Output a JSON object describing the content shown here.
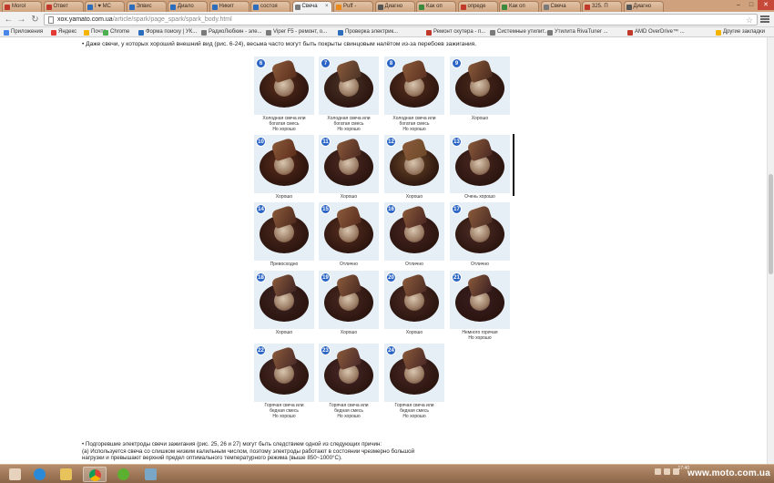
{
  "browser": {
    "tabs": [
      {
        "label": "Morol",
        "color": "#c0392b"
      },
      {
        "label": "Ответ",
        "color": "#c0392b"
      },
      {
        "label": "I ♥ МС",
        "color": "#2c6ebd"
      },
      {
        "label": "Элвис",
        "color": "#2c6ebd"
      },
      {
        "label": "Диало",
        "color": "#2c6ebd"
      },
      {
        "label": "Никит",
        "color": "#2c6ebd"
      },
      {
        "label": "состоя",
        "color": "#2c6ebd"
      },
      {
        "label": "Свеча",
        "color": "#7a7a7a",
        "active": true
      },
      {
        "label": "Puff -",
        "color": "#ea8a1a"
      },
      {
        "label": "Диагно",
        "color": "#555555"
      },
      {
        "label": "Как оп",
        "color": "#3b8a3e"
      },
      {
        "label": "опреде",
        "color": "#c0392b"
      },
      {
        "label": "Как оп",
        "color": "#3b8a3e"
      },
      {
        "label": "Свеча",
        "color": "#7a7a7a"
      },
      {
        "label": "325. П",
        "color": "#c0392b"
      },
      {
        "label": "Диагно",
        "color": "#555555"
      }
    ],
    "url_host": "xox.yamato.com.ua",
    "url_path": "/article/spark/page_spark/spark_body.html",
    "bookmarks": [
      {
        "label": "Приложения",
        "color": "#4a86e8"
      },
      {
        "label": "Яндекс",
        "color": "#e53935"
      },
      {
        "label": "Почта",
        "color": "#f5b400"
      },
      {
        "label": "Chrome",
        "color": "#4caf50"
      },
      {
        "label": "Форма поиску | УК...",
        "color": "#2c6ebd"
      },
      {
        "label": "РадиоЛюбкин - эле...",
        "color": "#7a7a7a"
      },
      {
        "label": "Viper F5 - ремонт, о...",
        "color": "#7a7a7a"
      },
      {
        "label": "Проверка электрик...",
        "color": "#2c6ebd"
      },
      {
        "label": "Ремонт скутера - п...",
        "color": "#c0392b"
      },
      {
        "label": "Системные утилит...",
        "color": "#7a7a7a"
      },
      {
        "label": "Утилита RivaTuner ...",
        "color": "#7a7a7a"
      },
      {
        "label": "AMD OverDrive™ ...",
        "color": "#c0392b"
      },
      {
        "label": "Другие закладки",
        "color": "#f5b400"
      }
    ]
  },
  "page": {
    "intro": "• Даже свечи, у которых хороший внешний вид (рис. 6-24), весьма часто могут быть покрыты свинцовым налётом из-за перебоев зажигания.",
    "plugs": [
      {
        "num": "6",
        "caption": [
          "Холодная свеча или",
          "богатая смесь",
          "Но хорошо"
        ],
        "tint": "#5a2e1c"
      },
      {
        "num": "7",
        "caption": [
          "Холодная свеча или",
          "богатая смесь",
          "Но хорошо"
        ],
        "tint": "#4b3326"
      },
      {
        "num": "8",
        "caption": [
          "Холодная свеча или",
          "богатая смесь",
          "Но хорошо"
        ],
        "tint": "#5b3120"
      },
      {
        "num": "9",
        "caption": [
          "Хорошо"
        ],
        "tint": "#4a2a1d"
      },
      {
        "num": "10",
        "caption": [
          "Хорошо"
        ],
        "tint": "#5d2d1b"
      },
      {
        "num": "11",
        "caption": [
          "Хорошо"
        ],
        "tint": "#4d2a22"
      },
      {
        "num": "12",
        "caption": [
          "Хорошо"
        ],
        "tint": "#6d4a2a"
      },
      {
        "num": "13",
        "caption": [
          "Очень хорошо"
        ],
        "tint": "#4a2822"
      },
      {
        "num": "14",
        "caption": [
          "Превосходно"
        ],
        "tint": "#4e2a1e"
      },
      {
        "num": "15",
        "caption": [
          "Отлично"
        ],
        "tint": "#5a2f20"
      },
      {
        "num": "16",
        "caption": [
          "Отлично"
        ],
        "tint": "#4a2622"
      },
      {
        "num": "17",
        "caption": [
          "Отлично"
        ],
        "tint": "#4e2e26"
      },
      {
        "num": "18",
        "caption": [
          "Хорошо"
        ],
        "tint": "#3e2424"
      },
      {
        "num": "19",
        "caption": [
          "Хорошо"
        ],
        "tint": "#4a2a22"
      },
      {
        "num": "20",
        "caption": [
          "Хорошо"
        ],
        "tint": "#4d2c24"
      },
      {
        "num": "21",
        "caption": [
          "Немного горячая",
          "Но хорошо"
        ],
        "tint": "#3a1f22"
      },
      {
        "num": "22",
        "caption": [
          "Горячая свеча или",
          "бедная смесь",
          "Но хорошо"
        ],
        "tint": "#4a2a28"
      },
      {
        "num": "23",
        "caption": [
          "Горячая свеча или",
          "бедная смесь",
          "Но хорошо"
        ],
        "tint": "#4a2a2a"
      },
      {
        "num": "24",
        "caption": [
          "Горячая свеча или",
          "бедная смесь",
          "Но хорошо"
        ],
        "tint": "#4a2826"
      }
    ],
    "footer": [
      "• Подгоревшие электроды свечи зажигания (рис. 25, 26 и 27) могут быть следствием одной из следующих причин:",
      "  (a) Используется свеча со слишком низким калильным числом, поэтому электроды работают в состоянии чрезмерно большой",
      "  нагрузки и превышают верхний предел оптимального температурного режима (выше 850~1000°С)."
    ]
  },
  "taskbar": {
    "clock_time": "17:40",
    "watermark": "www.moto.com.ua"
  }
}
